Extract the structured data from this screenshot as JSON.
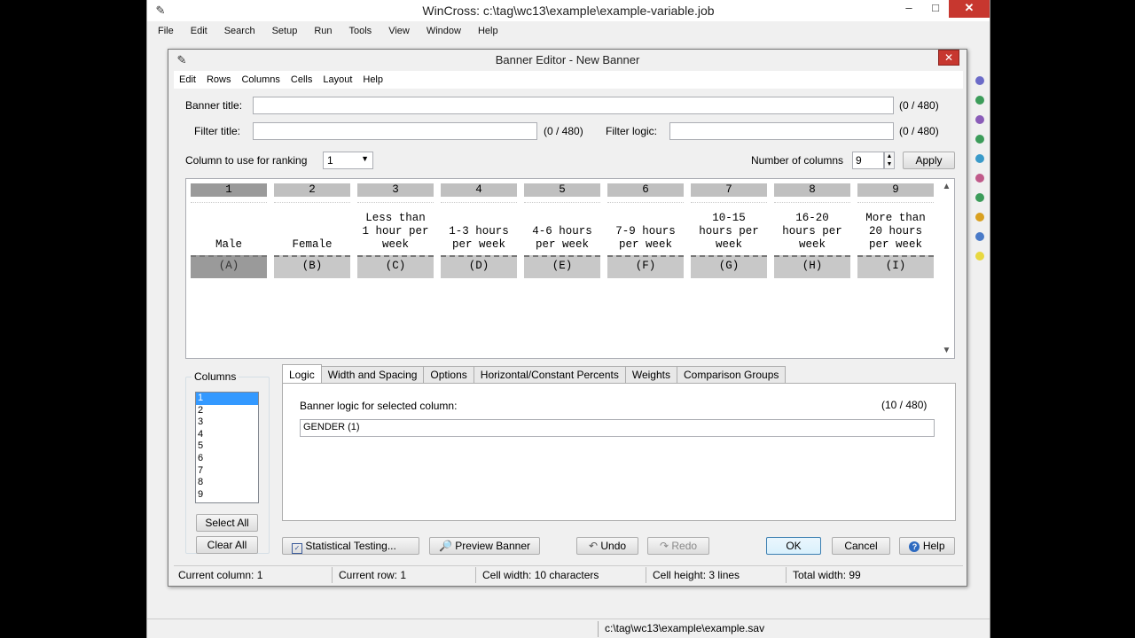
{
  "app": {
    "title": "WinCross: c:\\tag\\wc13\\example\\example-variable.job",
    "menu": [
      "File",
      "Edit",
      "Search",
      "Setup",
      "Run",
      "Tools",
      "View",
      "Window",
      "Help"
    ],
    "status_path": "c:\\tag\\wc13\\example\\example.sav"
  },
  "dialog": {
    "title": "Banner Editor - New Banner",
    "menu": [
      "Edit",
      "Rows",
      "Columns",
      "Cells",
      "Layout",
      "Help"
    ],
    "banner_title": {
      "label": "Banner title:",
      "value": "",
      "count": "(0 / 480)"
    },
    "filter_title": {
      "label": "Filter title:",
      "value": "",
      "count": "(0 / 480)"
    },
    "filter_logic": {
      "label": "Filter logic:",
      "value": "",
      "count": "(0 / 480)"
    },
    "ranking": {
      "label": "Column to use for ranking",
      "value": "1"
    },
    "num_columns": {
      "label": "Number of columns",
      "value": "9"
    },
    "apply_label": "Apply",
    "banner_columns": [
      {
        "num": "1",
        "lines": [
          "Male"
        ],
        "letter": "(A)"
      },
      {
        "num": "2",
        "lines": [
          "Female"
        ],
        "letter": "(B)"
      },
      {
        "num": "3",
        "lines": [
          "Less than",
          "1 hour per",
          "week"
        ],
        "letter": "(C)"
      },
      {
        "num": "4",
        "lines": [
          "1-3 hours",
          "per week"
        ],
        "letter": "(D)"
      },
      {
        "num": "5",
        "lines": [
          "4-6 hours",
          "per week"
        ],
        "letter": "(E)"
      },
      {
        "num": "6",
        "lines": [
          "7-9 hours",
          "per week"
        ],
        "letter": "(F)"
      },
      {
        "num": "7",
        "lines": [
          "10-15",
          "hours per",
          "week"
        ],
        "letter": "(G)"
      },
      {
        "num": "8",
        "lines": [
          "16-20",
          "hours per",
          "week"
        ],
        "letter": "(H)"
      },
      {
        "num": "9",
        "lines": [
          "More than",
          "20 hours",
          "per week"
        ],
        "letter": "(I)"
      }
    ],
    "columns_group": {
      "label": "Columns",
      "items": [
        "1",
        "2",
        "3",
        "4",
        "5",
        "6",
        "7",
        "8",
        "9"
      ],
      "selected": "1",
      "select_all": "Select All",
      "clear_all": "Clear All"
    },
    "tabs": [
      "Logic",
      "Width and Spacing",
      "Options",
      "Horizontal/Constant Percents",
      "Weights",
      "Comparison Groups"
    ],
    "active_tab": "Logic",
    "logic": {
      "label": "Banner logic for selected column:",
      "count": "(10 / 480)",
      "value": "GENDER (1)"
    },
    "buttons": {
      "stat_testing": "Statistical Testing...",
      "preview": "Preview Banner",
      "undo": "Undo",
      "redo": "Redo",
      "ok": "OK",
      "cancel": "Cancel",
      "help": "Help"
    },
    "status": {
      "current_column": "Current column: 1",
      "current_row": "Current row: 1",
      "cell_width": "Cell width: 10 characters",
      "cell_height": "Cell height: 3 lines",
      "total_width": "Total width: 99"
    }
  }
}
